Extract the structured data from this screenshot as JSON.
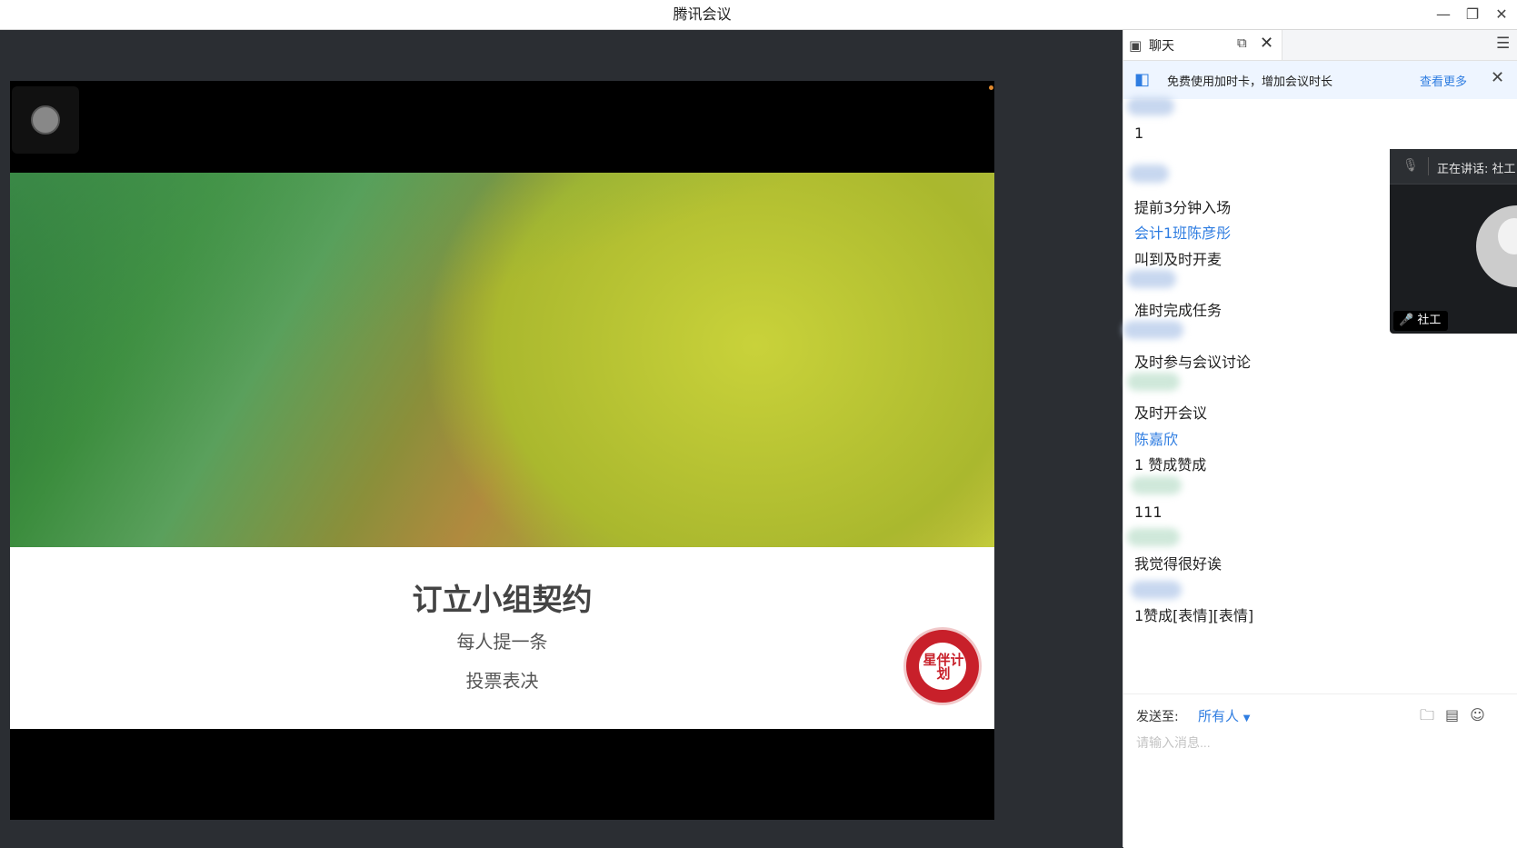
{
  "window": {
    "title": "腾讯会议",
    "controls": {
      "minimize": "—",
      "restore": "❐",
      "close": "✕"
    }
  },
  "slide": {
    "title": "订立小组契约",
    "lines": [
      "每人提一条",
      "投票表决"
    ],
    "logo_text": "星伴计划"
  },
  "chat": {
    "tab_label": "聊天",
    "promo": {
      "text": "免费使用加时卡，增加会议时长",
      "link": "查看更多"
    },
    "messages": [
      {
        "text": "1",
        "type": "text"
      },
      {
        "text": "提前3分钟入场",
        "type": "text"
      },
      {
        "text": "会计1班陈彦彤",
        "type": "link"
      },
      {
        "text": "叫到及时开麦",
        "type": "text"
      },
      {
        "text": "准时完成任务",
        "type": "text"
      },
      {
        "text": "及时参与会议讨论",
        "type": "text"
      },
      {
        "text": "及时开会议",
        "type": "text"
      },
      {
        "text": "陈嘉欣",
        "type": "link"
      },
      {
        "text": "1  赞成赞成",
        "type": "text"
      },
      {
        "text": "111",
        "type": "text"
      },
      {
        "text": "我觉得很好诶",
        "type": "text"
      },
      {
        "text": "1赞成[表情][表情]",
        "type": "text"
      }
    ],
    "compose": {
      "send_to_label": "发送至:",
      "send_to_value": "所有人",
      "input_placeholder": "请输入消息..."
    }
  },
  "speaker": {
    "label": "正在讲话: 社工",
    "name_tag": "社工"
  },
  "colors": {
    "accent": "#2f7de1",
    "stage_bg": "#2b2e33",
    "seal": "#c8202a"
  }
}
